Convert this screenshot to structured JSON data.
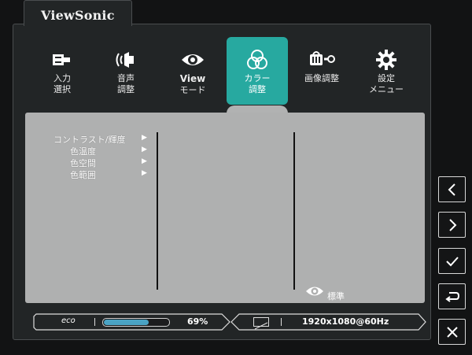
{
  "brand": {
    "name": "ViewSonic"
  },
  "tabs": [
    {
      "icon": "input-icon",
      "line1": "入力",
      "line2": "選択"
    },
    {
      "icon": "speaker-icon",
      "line1": "音声",
      "line2": "調整"
    },
    {
      "icon": "eye-icon",
      "line1": "View",
      "line2": "モード"
    },
    {
      "icon": "color-circles-icon",
      "line1": "カラー",
      "line2": "調整",
      "active": true
    },
    {
      "icon": "image-adjust-icon",
      "line1": "画像調整",
      "line2": ""
    },
    {
      "icon": "gear-icon",
      "line1": "設定",
      "line2": "メニュー"
    }
  ],
  "menu": {
    "items": [
      {
        "label": "コントラスト/輝度"
      },
      {
        "label": "色温度"
      },
      {
        "label": "色空間"
      },
      {
        "label": "色範囲"
      }
    ]
  },
  "mode": {
    "icon": "eye-icon",
    "label": "標準"
  },
  "status": {
    "eco_label": "eco",
    "brightness_fraction": 0.69,
    "brightness_text": "69%",
    "resolution": "1920x1080@60Hz"
  },
  "side_buttons": [
    {
      "name": "left-button",
      "icon": "chevron-left-icon"
    },
    {
      "name": "right-button",
      "icon": "chevron-right-icon"
    },
    {
      "name": "confirm-button",
      "icon": "check-icon"
    },
    {
      "name": "return-button",
      "icon": "return-icon"
    },
    {
      "name": "close-button",
      "icon": "close-icon"
    }
  ],
  "colors": {
    "accent": "#27a9a0",
    "panel": "#afb0b0",
    "progress": "#4aa3c4"
  }
}
